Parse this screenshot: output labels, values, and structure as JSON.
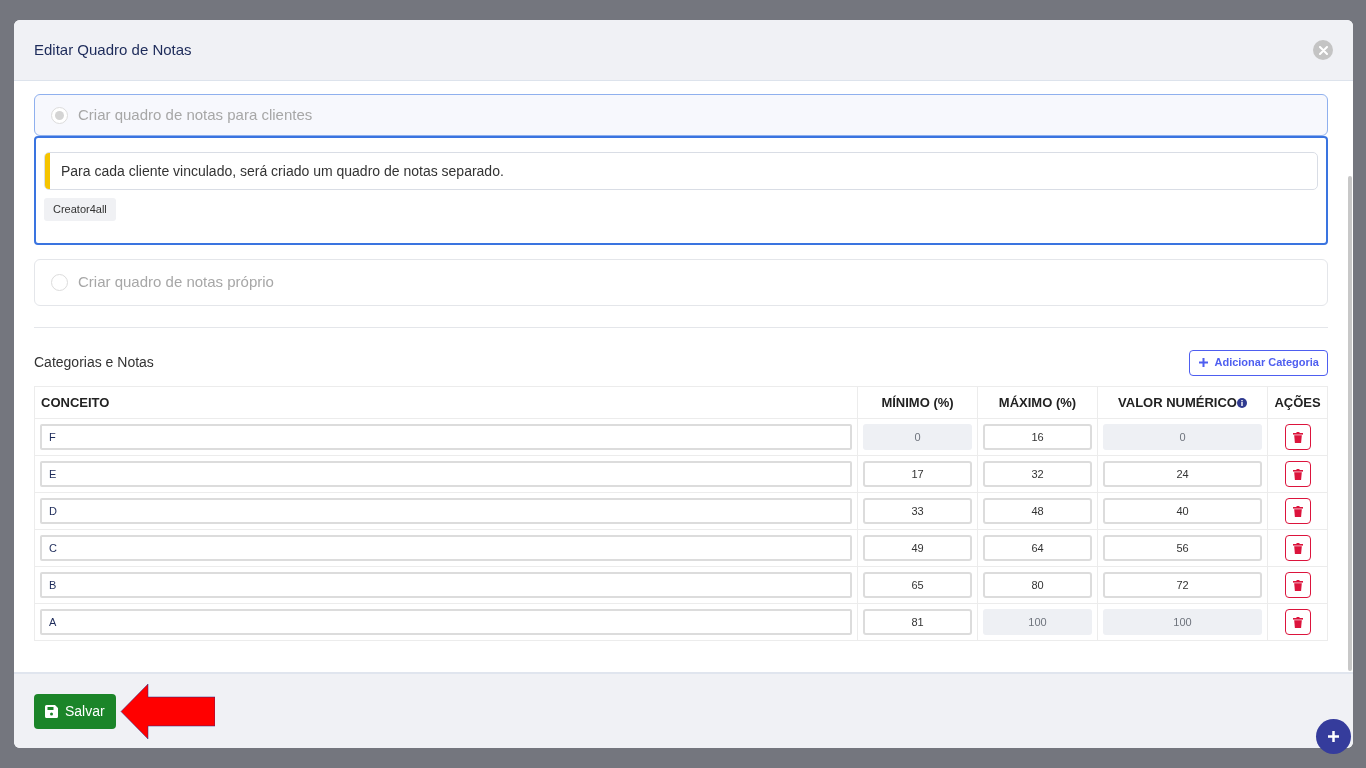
{
  "modal": {
    "title": "Editar Quadro de Notas"
  },
  "options": [
    {
      "label": "Criar quadro de notas para clientes",
      "selected": true,
      "disabled": true,
      "notice": "Para cada cliente vinculado, será criado um quadro de notas separado.",
      "tags": [
        "Creator4all"
      ]
    },
    {
      "label": "Criar quadro de notas próprio",
      "selected": false,
      "disabled": true
    }
  ],
  "section": {
    "title": "Categorias e Notas",
    "add_button": "Adicionar Categoria"
  },
  "table": {
    "columns": [
      "CONCEITO",
      "MÍNIMO (%)",
      "MÁXIMO (%)",
      "VALOR NUMÉRICO",
      "AÇÕES"
    ],
    "rows": [
      {
        "concept": "F",
        "min": {
          "value": "0",
          "disabled": true
        },
        "max": {
          "value": "16",
          "disabled": false
        },
        "numeric": {
          "value": "0",
          "disabled": true
        }
      },
      {
        "concept": "E",
        "min": {
          "value": "17",
          "disabled": false
        },
        "max": {
          "value": "32",
          "disabled": false
        },
        "numeric": {
          "value": "24",
          "disabled": false
        }
      },
      {
        "concept": "D",
        "min": {
          "value": "33",
          "disabled": false
        },
        "max": {
          "value": "48",
          "disabled": false
        },
        "numeric": {
          "value": "40",
          "disabled": false
        }
      },
      {
        "concept": "C",
        "min": {
          "value": "49",
          "disabled": false
        },
        "max": {
          "value": "64",
          "disabled": false
        },
        "numeric": {
          "value": "56",
          "disabled": false
        }
      },
      {
        "concept": "B",
        "min": {
          "value": "65",
          "disabled": false
        },
        "max": {
          "value": "80",
          "disabled": false
        },
        "numeric": {
          "value": "72",
          "disabled": false
        }
      },
      {
        "concept": "A",
        "min": {
          "value": "81",
          "disabled": false
        },
        "max": {
          "value": "100",
          "disabled": true
        },
        "numeric": {
          "value": "100",
          "disabled": true
        }
      }
    ]
  },
  "footer": {
    "save_button": "Salvar"
  }
}
